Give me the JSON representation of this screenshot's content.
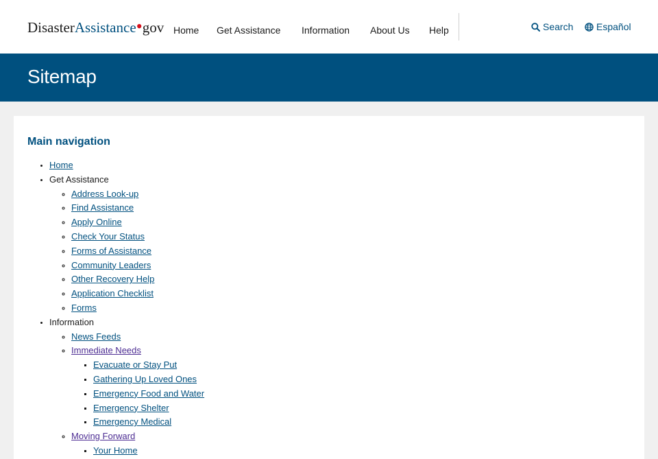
{
  "header": {
    "logo": {
      "part1": "Disaster",
      "part2": "Assistance",
      "dot": "•",
      "part3": "gov"
    },
    "nav": [
      "Home",
      "Get Assistance",
      "Information",
      "About Us",
      "Help"
    ],
    "search_label": "Search",
    "language_label": "Español",
    "search_icon": "search-icon",
    "language_icon": "globe-icon"
  },
  "banner": {
    "title": "Sitemap"
  },
  "main": {
    "heading": "Main navigation",
    "home": "Home",
    "get_assistance": {
      "label": "Get Assistance",
      "items": [
        "Address Look-up",
        "Find Assistance",
        "Apply Online",
        "Check Your Status",
        "Forms of Assistance",
        "Community Leaders",
        "Other Recovery Help",
        "Application Checklist",
        "Forms"
      ]
    },
    "information": {
      "label": "Information",
      "news_feeds": "News Feeds",
      "immediate_needs": {
        "label": "Immediate Needs",
        "items": [
          "Evacuate or Stay Put",
          "Gathering Up Loved Ones",
          "Emergency Food and Water",
          "Emergency Shelter",
          "Emergency Medical"
        ]
      },
      "moving_forward": {
        "label": "Moving Forward",
        "items": [
          "Your Home"
        ]
      }
    }
  },
  "colors": {
    "brand_blue": "#00507f",
    "visited_purple": "#4c2c92",
    "logo_red": "#d6111c",
    "page_bg": "#f0f0f0"
  }
}
